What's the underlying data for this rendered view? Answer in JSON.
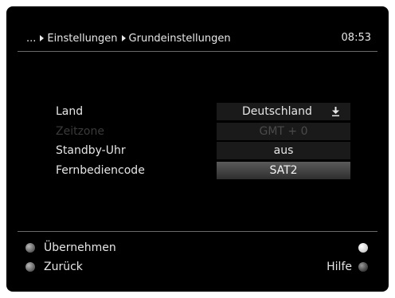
{
  "header": {
    "breadcrumb": [
      "...",
      "Einstellungen",
      "Grundeinstellungen"
    ],
    "time": "08:53"
  },
  "settings": [
    {
      "label": "Land",
      "value": "Deutschland",
      "has_dropdown": true,
      "state": "normal"
    },
    {
      "label": "Zeitzone",
      "value": "GMT + 0",
      "has_dropdown": false,
      "state": "disabled"
    },
    {
      "label": "Standby-Uhr",
      "value": "aus",
      "has_dropdown": false,
      "state": "normal"
    },
    {
      "label": "Fernbediencode",
      "value": "SAT2",
      "has_dropdown": false,
      "state": "selected"
    }
  ],
  "footer": {
    "accept_label": "Übernehmen",
    "back_label": "Zurück",
    "help_label": "Hilfe"
  },
  "colors": {
    "background": "#000000",
    "text": "#e6e6e6",
    "disabled_text": "#3a3a3a",
    "field": "#1a1a1a",
    "selected_field": "#4a4a4a"
  }
}
